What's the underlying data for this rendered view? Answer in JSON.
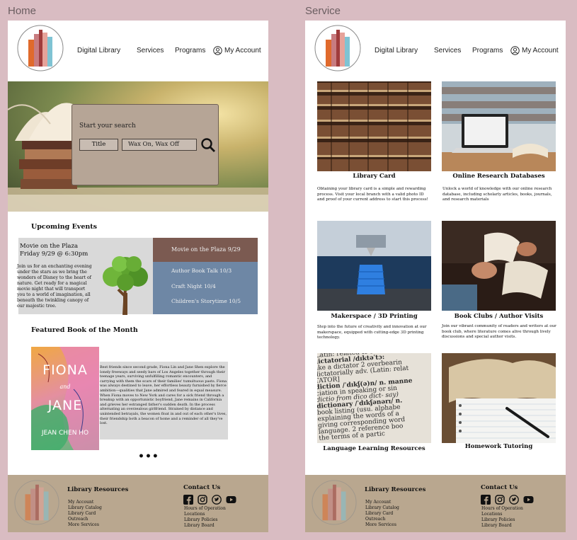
{
  "frames": {
    "home_label": "Home",
    "service_label": "Service"
  },
  "nav": {
    "digital_library": "Digital Library",
    "services": "Services",
    "programs": "Programs",
    "my_account": "My Account"
  },
  "hero": {
    "search_label": "Start your search",
    "search_type": "Title",
    "search_value": "Wax On, Wax Off"
  },
  "events": {
    "heading": "Upcoming Events",
    "feature_title": "Movie on the Plaza",
    "feature_date": "Friday 9/29 @ 6:30pm",
    "feature_desc": "Join us for an enchanting evening under the stars as we bring the wonders of Disney to the heart of nature. Get ready for a magical movie night that will transport you to a world of imagination, all beneath the twinkling canopy of our majestic tree.",
    "list": [
      "Movie on the Plaza 9/29",
      "Author Book Talk 10/3",
      "Craft Night 10/4",
      "Children's Storytime 10/5"
    ]
  },
  "featured": {
    "heading": "Featured Book of the Month",
    "cover_title_1": "FIONA",
    "cover_and": "and",
    "cover_title_2": "JANE",
    "cover_author": "JEAN CHEN HO",
    "summary": "Best friends since second grade, Fiona Lin and Jane Shen explore the lonely freeways and seedy bars of Los Angeles together through their teenage years, surviving unfulfilling romantic encounters, and carrying with them the scars of their families' tumultuous pasts. Fiona was always destined to leave, her effortless beauty furnished by fierce ambition—qualities that Jane admired and feared in equal measure. When Fiona moves to New York and cares for a sick friend through a breakup with an opportunistic boyfriend, Jane remains in California and grieves her estranged father's sudden death. In the process alternating an overzealous girlfriend. Strained by distance and unintended betrayals, the women float in and out of each other's lives, their friendship both a beacon of home and a reminder of all they've lost.",
    "more": "•••"
  },
  "footer": {
    "resources_title": "Library Resources",
    "resources": [
      "My Account",
      "Library Catalog",
      "Library Card",
      "Outreach",
      "More Services"
    ],
    "contact_title": "Contact Us",
    "contact_links": [
      "Hours of Operation",
      "Locations",
      "Library Policies",
      "Library Board"
    ],
    "social_icons": [
      "facebook-icon",
      "instagram-icon",
      "twitter-icon",
      "youtube-icon"
    ]
  },
  "services": [
    {
      "title": "Library Card",
      "desc": "Obtaining your library card is a simple and rewarding process. Visit your local branch with a valid photo ID and  proof of your current address to start this process!"
    },
    {
      "title": "Online Research Databases",
      "desc": "Unlock a world of knowledge with our online research database, including scholarly articles, books, journals, and research materials"
    },
    {
      "title": "Makerspace / 3D Printing",
      "desc": "Step into the future of creativity and innovation at our makerspace, equipped with cutting-edge 3D printing technology."
    },
    {
      "title": "Book Clubs / Author Visits",
      "desc": "Join our vibrant community of readers and writers at our book club, where literature comes alive through lively discussions and special author visits."
    },
    {
      "title": "Language Learning  Resources",
      "desc": ""
    },
    {
      "title": "Homework Tutoring",
      "desc": ""
    }
  ],
  "dictionary_text": [
    "(Latin: related to scr",
    "dictatorial /dɪktəˈtɔ:",
    "like a dictator 2 overbearin",
    "dictatorially adv. (Latin: relat",
    "TATOR]",
    "diction /ˈdɪkʃ(ə)n/ n. manne",
    "ciation in speaking or sin",
    "dictio from dico dict- say)",
    "dictionary /ˈdɪkʃənərɪ/ n.",
    "book listing (usu. alphabe",
    "explaining the words of a",
    "giving corresponding word",
    "language. 2 reference boo",
    "the terms of a partic"
  ],
  "colors": {
    "page_bg": "#d9bcc2",
    "footer_bg": "#b9a78f",
    "event_active": "#7b5a51",
    "event_list": "#6e87a5",
    "search_panel": "#b6a596"
  }
}
